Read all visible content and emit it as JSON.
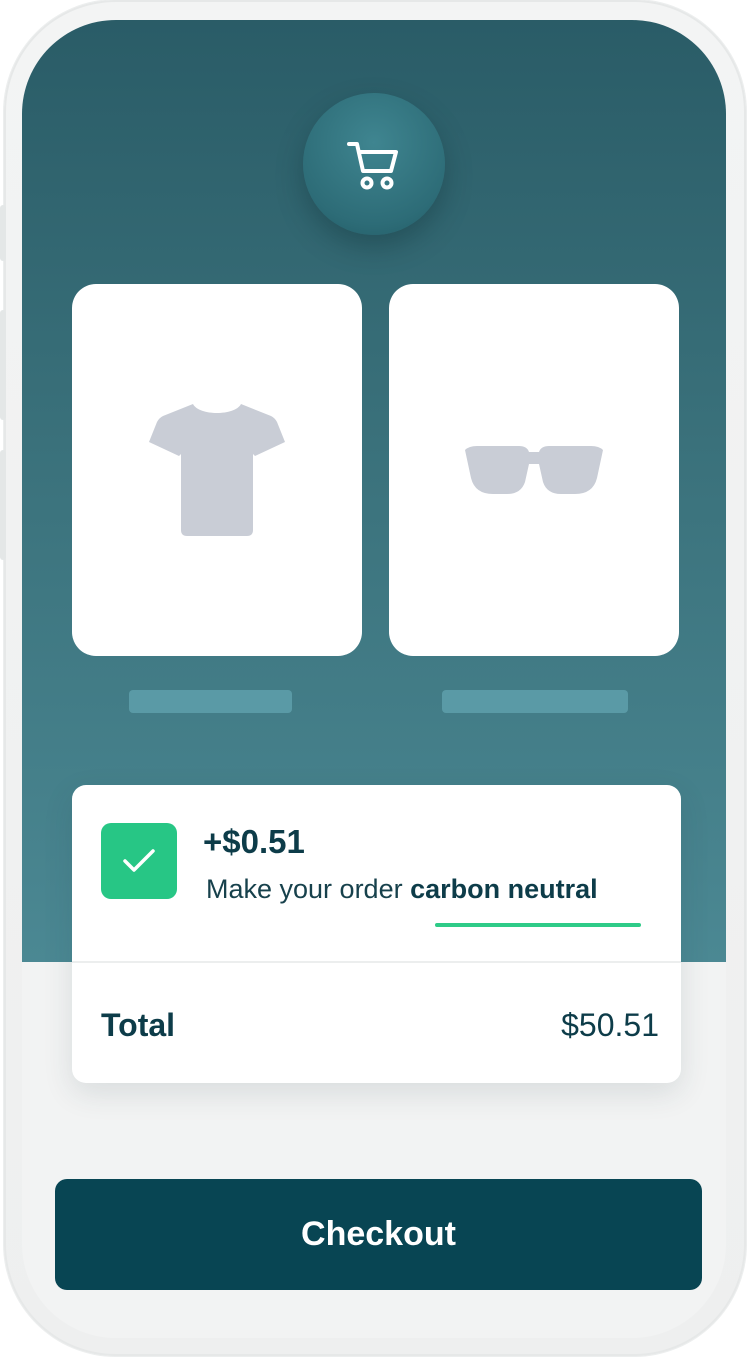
{
  "header": {
    "cart_icon": "shopping-cart-icon"
  },
  "products": [
    {
      "icon": "t-shirt-icon"
    },
    {
      "icon": "sunglasses-icon"
    }
  ],
  "offset": {
    "price": "+$0.51",
    "text_prefix": "Make your order ",
    "text_emphasis": "carbon neutral",
    "checked": true,
    "check_icon": "checkmark-icon"
  },
  "summary": {
    "total_label": "Total",
    "total_value": "$50.51"
  },
  "checkout": {
    "label": "Checkout"
  },
  "colors": {
    "hero_top": "#2a5c67",
    "hero_bottom": "#4b8893",
    "accent_green": "#27c685",
    "button": "#084553",
    "text_dark": "#0d3c49",
    "product_icon": "#c9cdd6"
  }
}
